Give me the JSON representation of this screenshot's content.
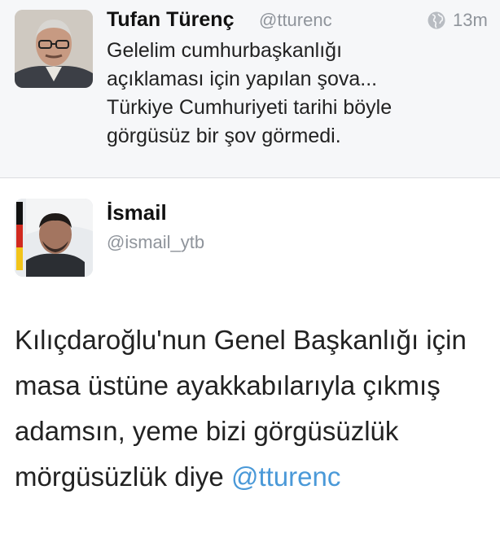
{
  "quoted_tweet": {
    "author_name": "Tufan Türenç",
    "handle": "@tturenc",
    "time": "13m",
    "text": "Gelelim cumhurbaşkanlığı\naçıklaması için yapılan şova...\nTürkiye Cumhuriyeti tarihi böyle\ngörgüsüz bir şov görmedi.",
    "globe_icon": "globe-icon"
  },
  "main_tweet": {
    "author_name": "İsmail",
    "handle": "@ismail_ytb",
    "text": "Kılıçdaroğlu'nun Genel Başkanlığı için masa üstüne ayakkabılarıyla çıkmış adamsın, yeme bizi görgüsüzlük mörgüsüzlük diye",
    "mention": "@tturenc"
  },
  "colors": {
    "mention": "#4a99d8",
    "secondary_text": "#8f949b",
    "quoted_background": "#f6f7f9"
  }
}
